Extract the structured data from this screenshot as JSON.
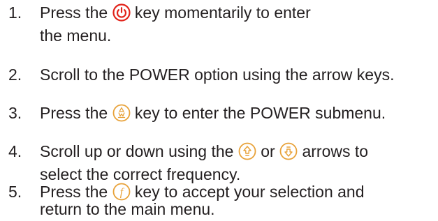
{
  "steps": [
    {
      "number": "1.",
      "line1_before": "Press the ",
      "icon": "power-icon",
      "line1_after": " key momentarily to enter",
      "line2": "the menu."
    },
    {
      "number": "2.",
      "line1": "Scroll to the POWER option using the arrow keys."
    },
    {
      "number": "3.",
      "line1_before": "Press the ",
      "icon": "enter-key-icon",
      "line1_after": " key to enter the POWER submenu."
    },
    {
      "number": "4.",
      "line1_before": "Scroll up or down using the ",
      "icon_up": "up-arrow-key-icon",
      "line1_mid": " or ",
      "icon_down": "down-arrow-key-icon",
      "line1_after": " arrows to",
      "line2": "select the correct frequency."
    },
    {
      "number": "5.",
      "line1_before": "Press the ",
      "icon": "function-key-icon",
      "line1_after": " key to accept your selection and",
      "line2": "return to the main menu."
    }
  ],
  "colors": {
    "text": "#231f20",
    "power_icon": "#e2231a",
    "key_icon": "#e8a23a"
  }
}
